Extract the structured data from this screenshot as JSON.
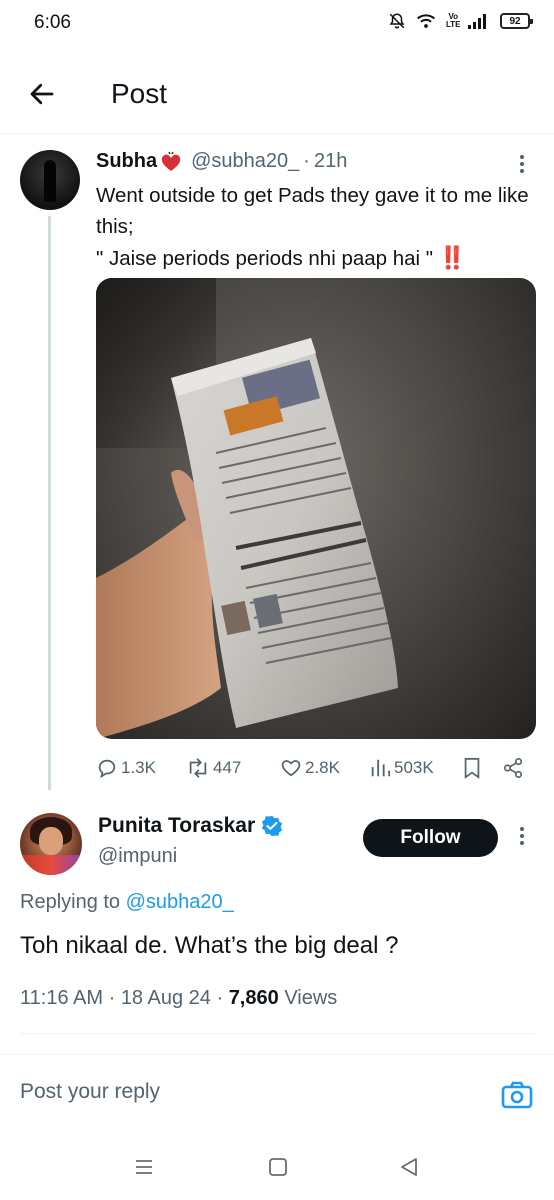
{
  "status": {
    "time": "6:06",
    "network": "Vo LTE",
    "battery": "92"
  },
  "header": {
    "title": "Post"
  },
  "post1": {
    "author_name": "Subha",
    "handle": "@subha20_",
    "separator": "·",
    "time": "21h",
    "text_line1": "Went outside to get Pads they gave it to me like this;",
    "text_line2": "\" Jaise periods periods nhi paap hai \"",
    "emoji": "‼️",
    "stats": {
      "replies": "1.3K",
      "reposts": "447",
      "likes": "2.8K",
      "views": "503K"
    }
  },
  "post2": {
    "author_name": "Punita Toraskar",
    "handle": "@impuni",
    "follow_label": "Follow",
    "replying_prefix": "Replying to",
    "replying_handle": "@subha20_",
    "text": "Toh nikaal de. What’s the big deal ?",
    "time": "11:16 AM",
    "date": "18 Aug 24",
    "views_count": "7,860",
    "views_label": "Views"
  },
  "reply": {
    "placeholder": "Post your reply"
  },
  "colors": {
    "accent": "#1d9bf0",
    "text": "#0f1419",
    "secondary": "#536471",
    "verified": "#1d9bf0"
  }
}
